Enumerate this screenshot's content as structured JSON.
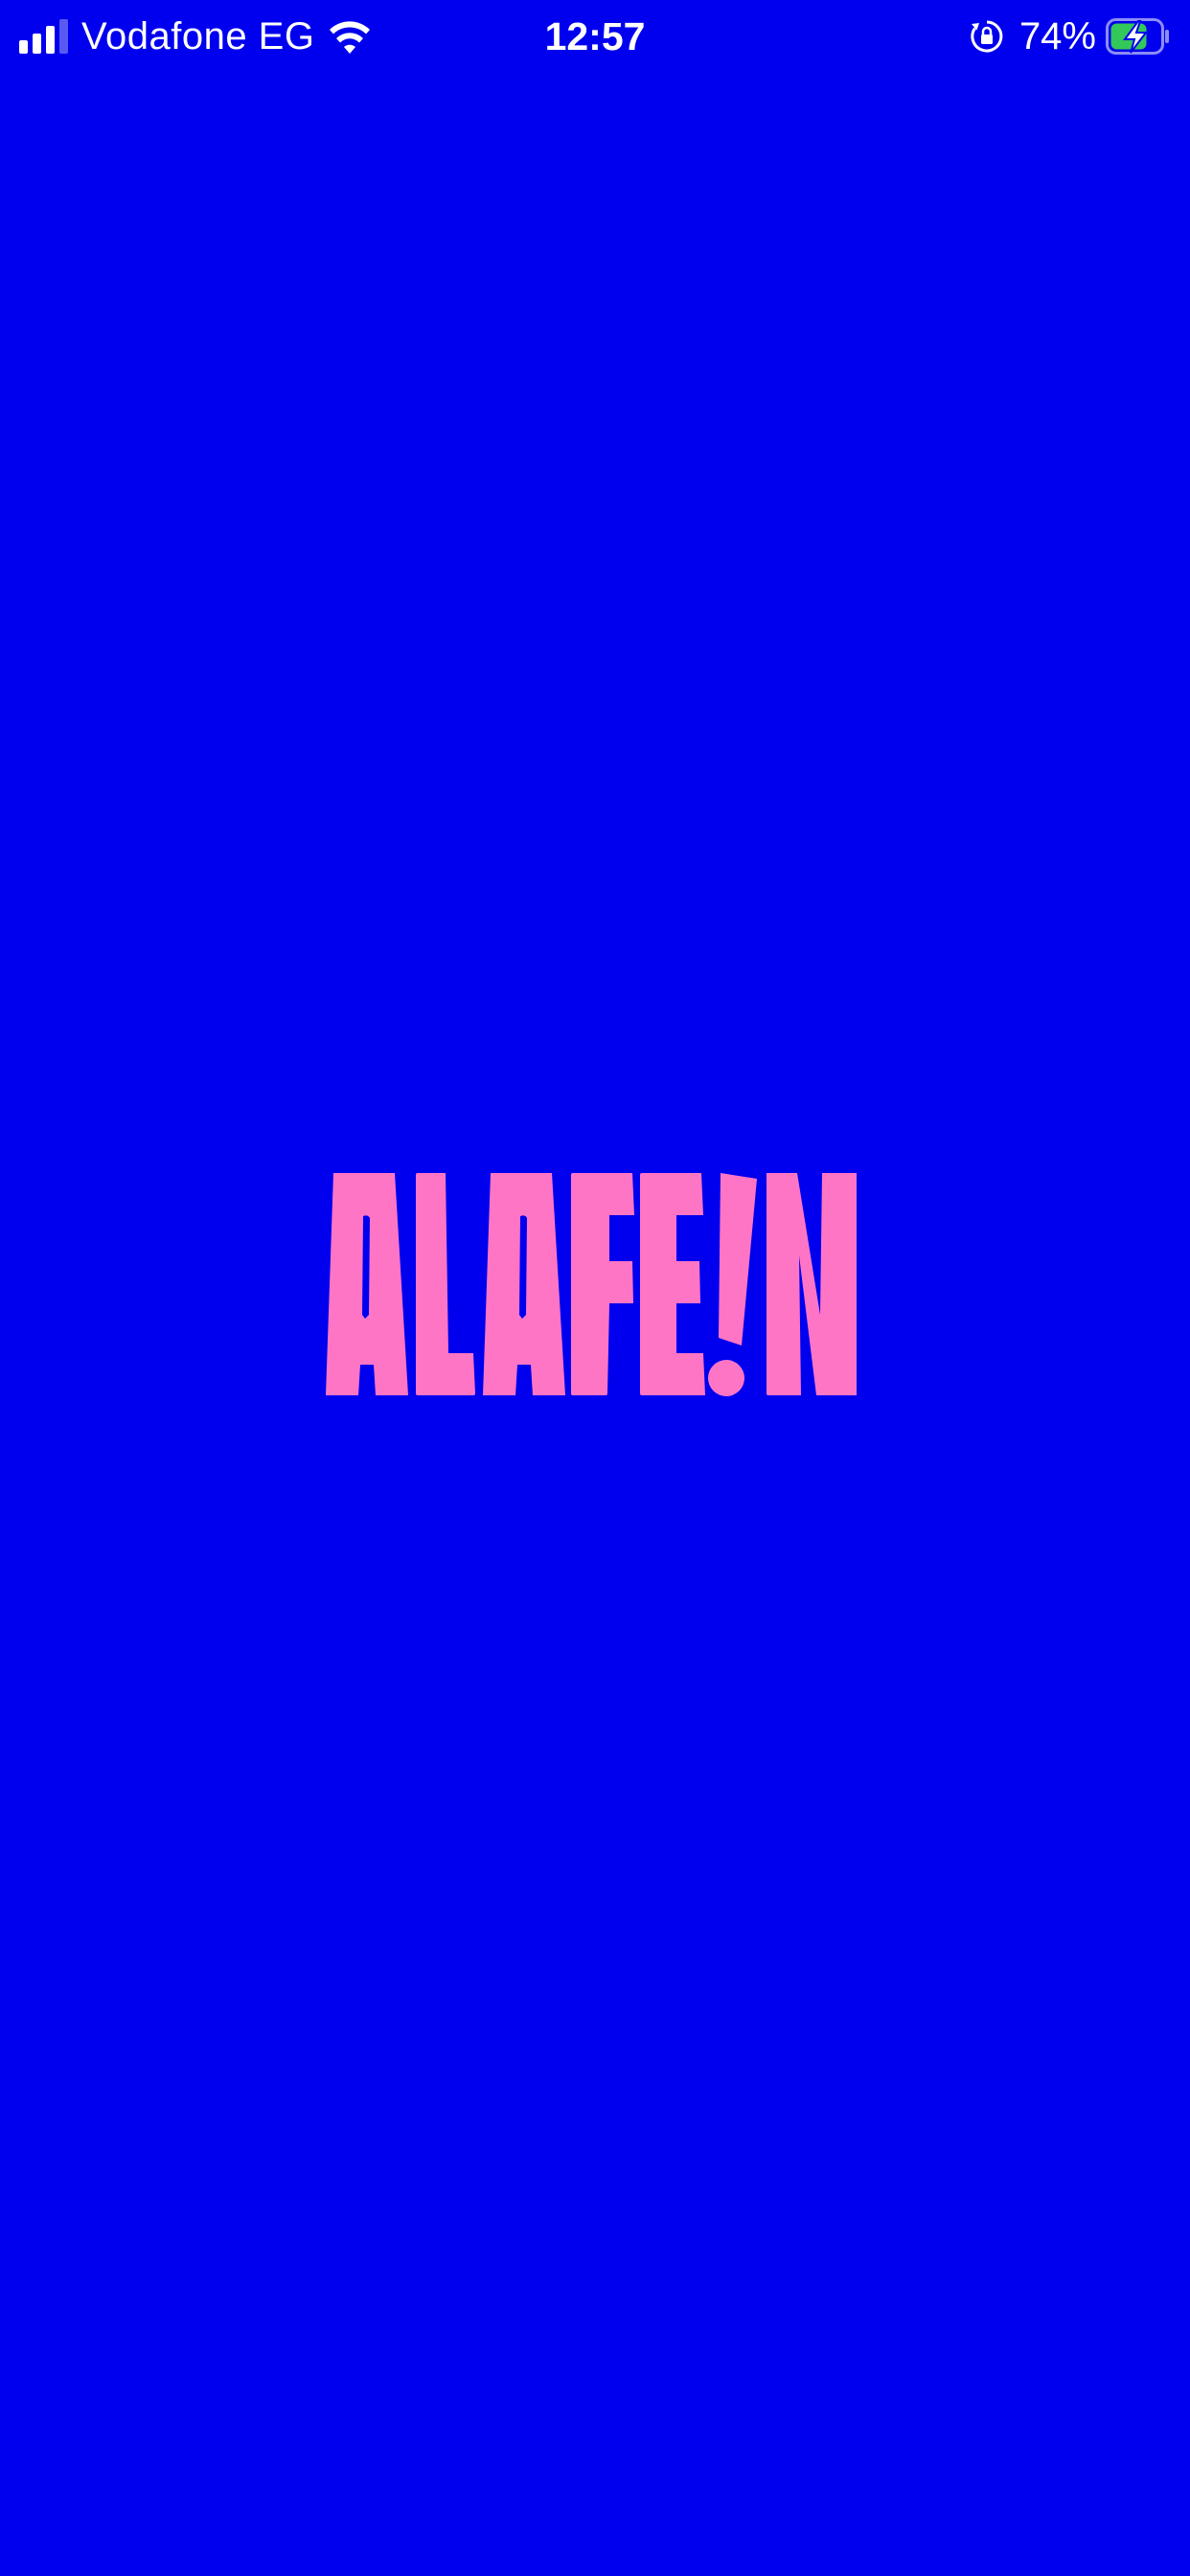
{
  "status_bar": {
    "carrier": "Vodafone EG",
    "time": "12:57",
    "battery_percent": "74%",
    "battery_level": 0.74,
    "signal_bars_active": 3,
    "signal_bars_total": 4,
    "charging": true
  },
  "splash": {
    "logo_text": "ALAFE!N"
  },
  "colors": {
    "background": "#0000ee",
    "logo": "#ff75c6",
    "battery_fill": "#34c759",
    "status_text": "#ffffff"
  },
  "icons": {
    "signal": "cellular-signal-icon",
    "wifi": "wifi-icon",
    "orientation_lock": "orientation-lock-icon",
    "battery": "battery-charging-icon"
  }
}
